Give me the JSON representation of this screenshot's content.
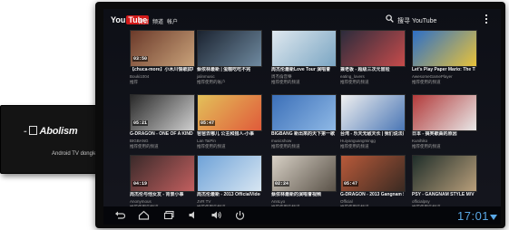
{
  "dongle": {
    "brand": "Abolism",
    "caption": "Android TV dongle"
  },
  "header": {
    "logo_you": "You",
    "logo_tube": "Tube",
    "nav": [
      "首页",
      "频道",
      "帐户"
    ],
    "search_placeholder": "搜寻 YouTube"
  },
  "videos": [
    {
      "title": "【chuca-more】小木川情歌試唱的一名其他",
      "channel": "Bouki1004",
      "views": "推荐",
      "tag": "",
      "duration": "03:50",
      "colors": [
        "#6b3a2a",
        "#c9a27a"
      ]
    },
    {
      "title": "蔡依林最新 | 蛋糕吃吃不完",
      "channel": "jalinmusic",
      "views": "推荐使用的账户",
      "tag": "",
      "duration": "",
      "colors": [
        "#1b2330",
        "#6f8aa0"
      ]
    },
    {
      "title": "周杰伦最新Love Tour 演唱會",
      "channel": "周杰倫音樂",
      "views": "推荐使用的频道",
      "tag": "",
      "duration": "",
      "colors": [
        "#dfe8ef",
        "#7ba6c3"
      ]
    },
    {
      "title": "兼老板 - 超级三次元冒险",
      "channel": "eating_lovers",
      "views": "推荐使用的频道",
      "tag": "",
      "duration": "",
      "colors": [
        "#2c2c3c",
        "#c64b4b"
      ]
    },
    {
      "title": "Let's Play Paper Mario: The Thousand Year Door - Episode 1",
      "channel": "AwesomeGamePlayer",
      "views": "推荐使用的频道",
      "tag": "",
      "duration": "",
      "colors": [
        "#2d6fc7",
        "#e8c23a"
      ]
    },
    {
      "title": "G-DRAGON - ONE OF A KIND M/V",
      "channel": "BIGBANG",
      "views": "推荐使用的频道",
      "tag": "",
      "duration": "05:21",
      "colors": [
        "#2a2a2a",
        "#cfcfcf"
      ]
    },
    {
      "title": "爸爸去哪儿 公主和猎人-小事",
      "channel": "Lan TaiPin",
      "views": "推荐使用的频道",
      "tag": "",
      "duration": "05:47",
      "colors": [
        "#e3c15a",
        "#e05a3a"
      ]
    },
    {
      "title": "BIGBANG 新出來的天下第一歌曲 2013",
      "channel": "musicshow",
      "views": "推荐使用的频道",
      "tag": "",
      "duration": "",
      "colors": [
        "#3b6fb8",
        "#8fb9e6"
      ]
    },
    {
      "title": "台湾 - 乐天无敌天长 | 我们说法是做朋友",
      "channel": "Huiyanguangmingg",
      "views": "推荐使用的频道",
      "tag": "",
      "duration": "",
      "colors": [
        "#f0f0f0",
        "#4a76b5"
      ]
    },
    {
      "title": "日本 - 搞笑歌曲的原因",
      "channel": "Kunihiko",
      "views": "推荐使用的频道",
      "tag": "",
      "duration": "",
      "colors": [
        "#b23a3a",
        "#e8e8e8"
      ]
    },
    {
      "title": "周杰伦与他女友 - 背景小事",
      "channel": "Anonymous",
      "views": "推荐使用的频道",
      "tag": "",
      "duration": "04:19",
      "colors": [
        "#3a2a2a",
        "#c25f5f"
      ]
    },
    {
      "title": "周杰伦最新 - 2013 OfficialVideo",
      "channel": "JVR TV",
      "views": "推荐使用的频道",
      "tag": "",
      "duration": "",
      "colors": [
        "#6ea2d8",
        "#d8e6f2"
      ]
    },
    {
      "title": "蔡依林最新的演唱會视频",
      "channel": "AnnLyo",
      "views": "推荐使用的频道",
      "tag": "",
      "duration": "02:24",
      "colors": [
        "#d7d0c5",
        "#5a5248"
      ]
    },
    {
      "title": "G-DRAGON - 2013 Gangnam Style Dance",
      "channel": "Official",
      "views": "推荐使用的频道",
      "tag": "",
      "duration": "05:47",
      "colors": [
        "#b85a3a",
        "#3a2a22"
      ]
    },
    {
      "title": "PSY - GANGNAM STYLE M/V by Daddy",
      "channel": "officialpsy",
      "views": "推荐使用的频道",
      "tag": "",
      "duration": "",
      "colors": [
        "#1f2e2a",
        "#b89e7a"
      ]
    }
  ],
  "system_bar": {
    "clock": "17:01"
  }
}
